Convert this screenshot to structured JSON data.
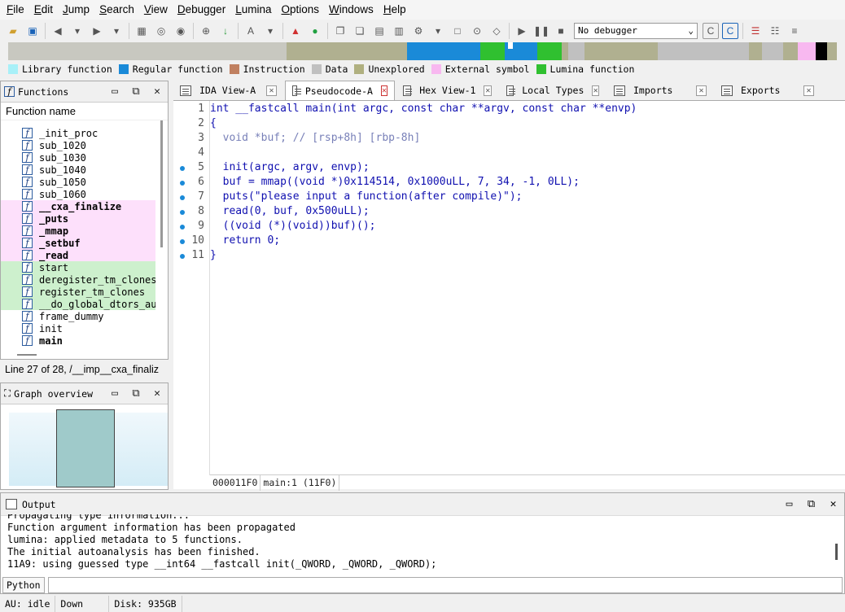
{
  "menu": [
    "File",
    "Edit",
    "Jump",
    "Search",
    "View",
    "Debugger",
    "Lumina",
    "Options",
    "Windows",
    "Help"
  ],
  "toolbar": {
    "debugger_select": "No debugger"
  },
  "legend": [
    {
      "label": "Library function",
      "color": "#a8f0f8"
    },
    {
      "label": "Regular function",
      "color": "#1a8ad8"
    },
    {
      "label": "Instruction",
      "color": "#c08060"
    },
    {
      "label": "Data",
      "color": "#c0c0c0"
    },
    {
      "label": "Unexplored",
      "color": "#b0b080"
    },
    {
      "label": "External symbol",
      "color": "#f8b8f0"
    },
    {
      "label": "Lumina function",
      "color": "#30c030"
    }
  ],
  "functions": {
    "title": "Functions",
    "column": "Function name",
    "items": [
      {
        "name": "_init_proc",
        "style": ""
      },
      {
        "name": "sub_1020",
        "style": ""
      },
      {
        "name": "sub_1030",
        "style": ""
      },
      {
        "name": "sub_1040",
        "style": ""
      },
      {
        "name": "sub_1050",
        "style": ""
      },
      {
        "name": "sub_1060",
        "style": ""
      },
      {
        "name": "__cxa_finalize",
        "style": "pink bold"
      },
      {
        "name": "_puts",
        "style": "pink bold"
      },
      {
        "name": "_mmap",
        "style": "pink bold"
      },
      {
        "name": "_setbuf",
        "style": "pink bold"
      },
      {
        "name": "_read",
        "style": "pink bold"
      },
      {
        "name": "start",
        "style": "green"
      },
      {
        "name": "deregister_tm_clones",
        "style": "green"
      },
      {
        "name": "register_tm_clones",
        "style": "green"
      },
      {
        "name": "__do_global_dtors_aux",
        "style": "green"
      },
      {
        "name": "frame_dummy",
        "style": ""
      },
      {
        "name": "init",
        "style": ""
      },
      {
        "name": "main",
        "style": "bold"
      }
    ],
    "status": "Line 27 of 28, /__imp__cxa_finaliz"
  },
  "graph": {
    "title": "Graph overview"
  },
  "tabs": [
    {
      "label": "IDA View-A",
      "active": false
    },
    {
      "label": "Pseudocode-A",
      "active": true
    },
    {
      "label": "Hex View-1",
      "active": false
    },
    {
      "label": "Local Types",
      "active": false
    },
    {
      "label": "Imports",
      "active": false
    },
    {
      "label": "Exports",
      "active": false
    }
  ],
  "code": {
    "lines": [
      {
        "n": "1",
        "dot": false,
        "text": "int __fastcall main(int argc, const char **argv, const char **envp)"
      },
      {
        "n": "2",
        "dot": false,
        "text": "{"
      },
      {
        "n": "3",
        "dot": false,
        "text": "  void *buf; // [rsp+8h] [rbp-8h]"
      },
      {
        "n": "4",
        "dot": false,
        "text": ""
      },
      {
        "n": "5",
        "dot": true,
        "text": "  init(argc, argv, envp);"
      },
      {
        "n": "6",
        "dot": true,
        "text": "  buf = mmap((void *)0x114514, 0x1000uLL, 7, 34, -1, 0LL);"
      },
      {
        "n": "7",
        "dot": true,
        "text": "  puts(\"please input a function(after compile)\");"
      },
      {
        "n": "8",
        "dot": true,
        "text": "  read(0, buf, 0x500uLL);"
      },
      {
        "n": "9",
        "dot": true,
        "text": "  ((void (*)(void))buf)();"
      },
      {
        "n": "10",
        "dot": true,
        "text": "  return 0;"
      },
      {
        "n": "11",
        "dot": true,
        "text": "}"
      }
    ],
    "status_addr": "000011F0",
    "status_loc": "main:1 (11F0)"
  },
  "output": {
    "title": "Output",
    "lines": [
      "Propagating type information...",
      "Function argument information has been propagated",
      "lumina: applied metadata to 5 functions.",
      "The initial autoanalysis has been finished.",
      "11A9: using guessed type __int64 __fastcall init(_QWORD, _QWORD, _QWORD);"
    ],
    "python_label": "Python"
  },
  "statusbar": {
    "au": "AU:  idle",
    "dir": "Down",
    "disk": "Disk: 935GB"
  }
}
